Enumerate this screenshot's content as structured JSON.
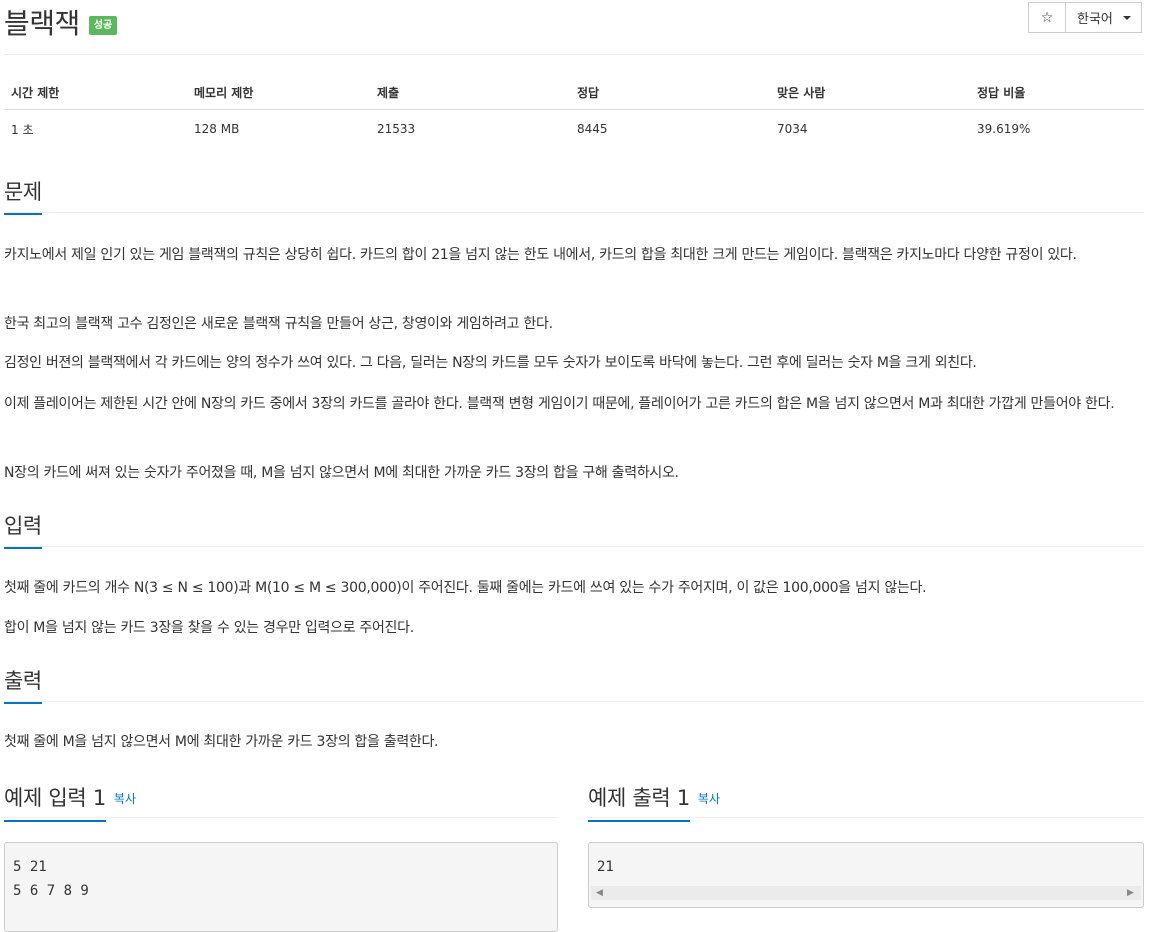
{
  "header": {
    "title": "블랙잭",
    "status_badge": "성공",
    "star_icon": "☆",
    "language_label": "한국어"
  },
  "stats": {
    "headers": [
      "시간 제한",
      "메모리 제한",
      "제출",
      "정답",
      "맞은 사람",
      "정답 비율"
    ],
    "values": [
      "1 초",
      "128 MB",
      "21533",
      "8445",
      "7034",
      "39.619%"
    ]
  },
  "problem": {
    "heading": "문제",
    "p1": "카지노에서 제일 인기 있는 게임 블랙잭의 규칙은 상당히 쉽다. 카드의 합이 21을 넘지 않는 한도 내에서, 카드의 합을 최대한 크게 만드는 게임이다. 블랙잭은 카지노마다 다양한 규정이 있다.",
    "p2": "한국 최고의 블랙잭 고수 김정인은 새로운 블랙잭 규칙을 만들어 상근, 창영이와 게임하려고 한다.",
    "p3": "김정인 버젼의 블랙잭에서 각 카드에는 양의 정수가 쓰여 있다. 그 다음, 딜러는 N장의 카드를 모두 숫자가 보이도록 바닥에 놓는다. 그런 후에 딜러는 숫자 M을 크게 외친다.",
    "p4": "이제 플레이어는 제한된 시간 안에 N장의 카드 중에서 3장의 카드를 골라야 한다. 블랙잭 변형 게임이기 때문에, 플레이어가 고른 카드의 합은 M을 넘지 않으면서 M과 최대한 가깝게 만들어야 한다.",
    "p5": "N장의 카드에 써져 있는 숫자가 주어졌을 때, M을 넘지 않으면서 M에 최대한 가까운 카드 3장의 합을 구해 출력하시오."
  },
  "input": {
    "heading": "입력",
    "p1": "첫째 줄에 카드의 개수 N(3 ≤ N ≤ 100)과 M(10 ≤ M ≤ 300,000)이 주어진다. 둘째 줄에는 카드에 쓰여 있는 수가 주어지며, 이 값은 100,000을 넘지 않는다.",
    "p2": "합이 M을 넘지 않는 카드 3장을 찾을 수 있는 경우만 입력으로 주어진다."
  },
  "output": {
    "heading": "출력",
    "p1": "첫째 줄에 M을 넘지 않으면서 M에 최대한 가까운 카드 3장의 합을 출력한다."
  },
  "sample_input": {
    "heading": "예제 입력 1",
    "copy_label": "복사",
    "content": "5 21\n5 6 7 8 9"
  },
  "sample_output": {
    "heading": "예제 출력 1",
    "copy_label": "복사",
    "content": "21"
  },
  "colors": {
    "accent": "#0076c0",
    "success": "#5cb85c"
  }
}
